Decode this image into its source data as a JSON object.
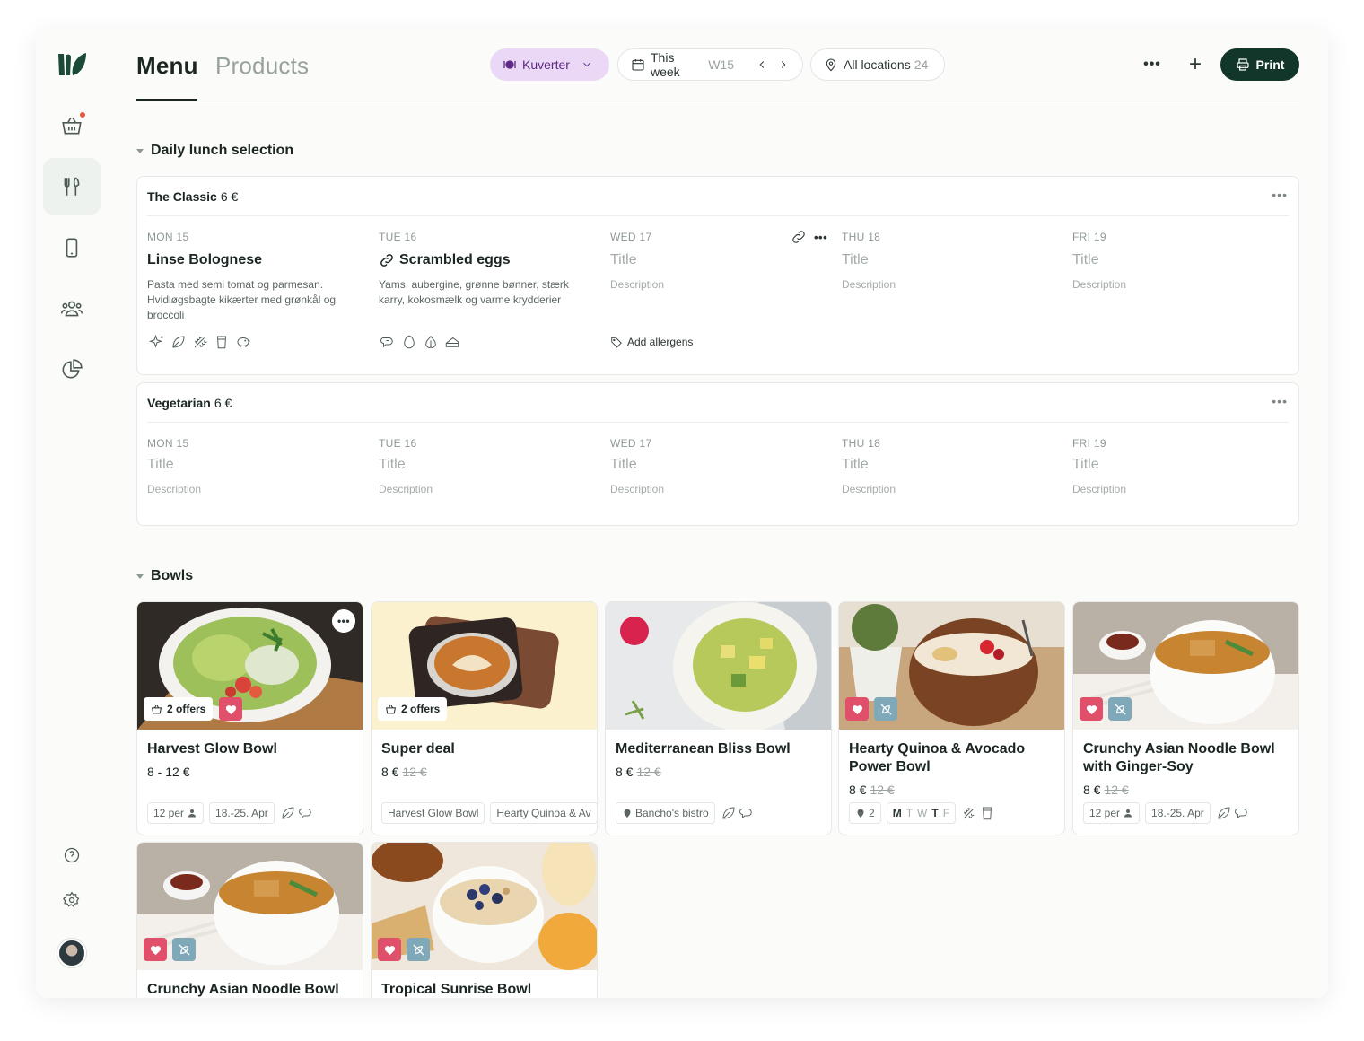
{
  "header": {
    "tabs": [
      {
        "label": "Menu",
        "active": true
      },
      {
        "label": "Products",
        "active": false
      }
    ],
    "kuverter": "Kuverter",
    "week": {
      "label": "This week",
      "week_no": "W15"
    },
    "locations": {
      "label": "All locations",
      "count": "24"
    },
    "print_label": "Print"
  },
  "sidebar": {
    "items": [
      "basket-icon",
      "cutlery-icon",
      "mobile-icon",
      "users-icon",
      "pie-chart-icon",
      "help-icon",
      "settings-icon"
    ],
    "notification_dot": true
  },
  "sections": {
    "daily": {
      "title": "Daily lunch selection"
    },
    "bowls": {
      "title": "Bowls"
    }
  },
  "menus": [
    {
      "name": "The Classic",
      "price": "6 €",
      "days": [
        {
          "label": "MON 15",
          "title": "Linse Bolognese",
          "description": "Pasta med semi tomat og parmesan. Hvidløgsbagte kikærter med grønkål og broccoli"
        },
        {
          "label": "TUE 16",
          "title": "Scrambled eggs",
          "description": "Yams, aubergine, grønne bønner, stærk karry, kokosmælk og varme krydderier"
        },
        {
          "label": "WED 17",
          "title": "Title",
          "description": "Description",
          "add_allergens": "Add allergens"
        },
        {
          "label": "THU 18",
          "title": "Title",
          "description": "Description"
        },
        {
          "label": "FRI 19",
          "title": "Title",
          "description": "Description"
        }
      ]
    },
    {
      "name": "Vegetarian",
      "price": "6 €",
      "days": [
        {
          "label": "MON 15",
          "title": "Title",
          "description": "Description"
        },
        {
          "label": "TUE 16",
          "title": "Title",
          "description": "Description"
        },
        {
          "label": "WED 17",
          "title": "Title",
          "description": "Description"
        },
        {
          "label": "THU 18",
          "title": "Title",
          "description": "Description"
        },
        {
          "label": "FRI 19",
          "title": "Title",
          "description": "Description"
        }
      ]
    }
  ],
  "products": [
    {
      "name": "Harvest Glow Bowl",
      "price": "8 - 12 €",
      "old_price": "",
      "offers": "2 offers",
      "chips": [
        "12 per",
        "18.-25. Apr"
      ]
    },
    {
      "name": "Super deal",
      "price": "8 €",
      "old_price": "12 €",
      "offers": "2 offers",
      "chips": [
        "Harvest Glow Bowl",
        "Hearty Quinoa & Av"
      ]
    },
    {
      "name": "Mediterranean Bliss Bowl",
      "price": "8 €",
      "old_price": "12 €",
      "chips": [
        "Bancho's bistro"
      ]
    },
    {
      "name": "Hearty Quinoa & Avocado Power Bowl",
      "price": "8 €",
      "old_price": "12 €",
      "chips": [
        "2"
      ],
      "days": [
        "M",
        "T",
        "W",
        "T",
        "F"
      ]
    },
    {
      "name": "Crunchy Asian Noodle Bowl with Ginger-Soy",
      "price": "8 €",
      "old_price": "12 €",
      "chips": [
        "12 per",
        "18.-25. Apr"
      ]
    },
    {
      "name": "Crunchy Asian Noodle Bowl"
    },
    {
      "name": "Tropical Sunrise Bowl"
    }
  ],
  "colors": {
    "brand": "#13362b",
    "kuverter_bg": "#ead8f6",
    "favorite": "#e0506a",
    "non_veg": "#7fa8b8"
  }
}
